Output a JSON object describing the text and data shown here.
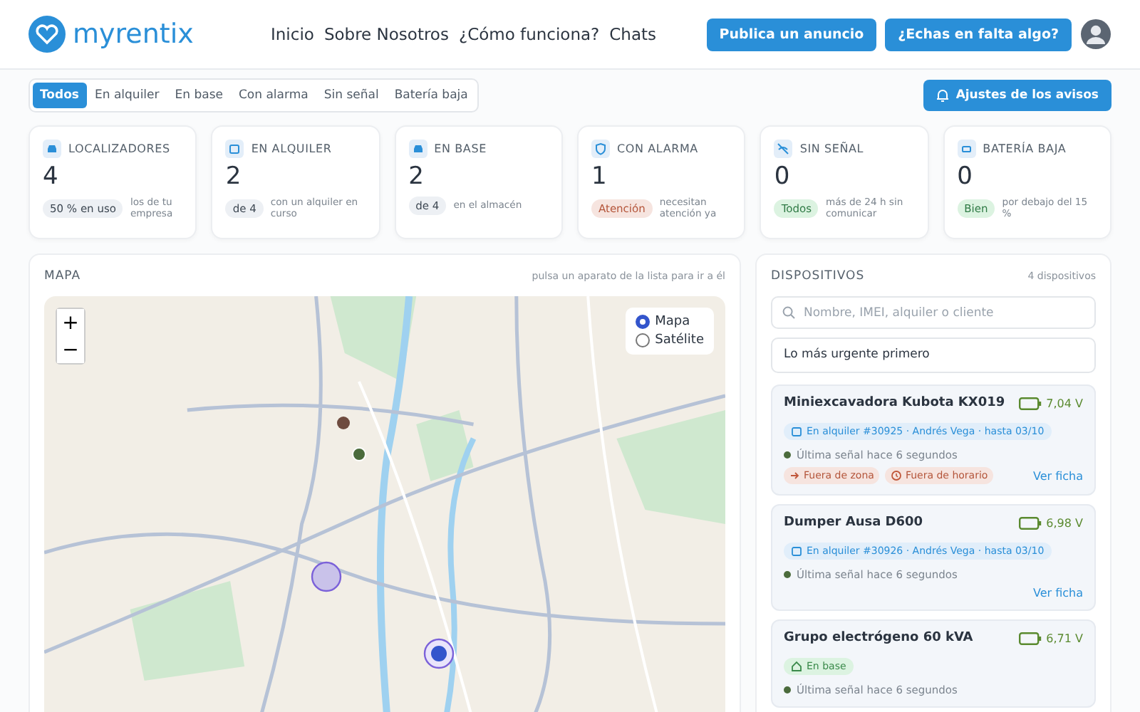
{
  "header": {
    "brand": "myrentix",
    "nav": [
      "Inicio",
      "Sobre Nosotros",
      "¿Cómo funciona?",
      "Chats"
    ],
    "buttons": [
      "Publica un anuncio",
      "¿Echas en falta algo?"
    ]
  },
  "filters": [
    {
      "label": "Todos",
      "selected": true
    },
    {
      "label": "En alquiler",
      "selected": false
    },
    {
      "label": "En base",
      "selected": false
    },
    {
      "label": "Con alarma",
      "selected": false
    },
    {
      "label": "Sin señal",
      "selected": false
    },
    {
      "label": "Batería baja",
      "selected": false
    }
  ],
  "alerts_button": "Ajustes de los avisos",
  "stats": [
    {
      "kind": "trackers",
      "title": "LOCALIZADORES",
      "value": "4",
      "badge": {
        "kind": "neutral",
        "label": "50 % en uso"
      },
      "note": "los de tu empresa"
    },
    {
      "kind": "rental",
      "title": "EN ALQUILER",
      "value": "2",
      "badge": {
        "kind": "neutral",
        "label": "de 4"
      },
      "note": "con un alquiler en curso"
    },
    {
      "kind": "base",
      "title": "EN BASE",
      "value": "2",
      "badge": {
        "kind": "neutral",
        "label": "de 4"
      },
      "note": "en el almacén"
    },
    {
      "kind": "alarm",
      "title": "CON ALARMA",
      "value": "1",
      "badge": {
        "kind": "danger",
        "label": "Atención"
      },
      "note": "necesitan atención ya"
    },
    {
      "kind": "signal",
      "title": "SIN SEÑAL",
      "value": "0",
      "badge": {
        "kind": "success",
        "label": "Todos"
      },
      "note": "más de 24 h sin comunicar"
    },
    {
      "kind": "battery",
      "title": "BATERÍA BAJA",
      "value": "0",
      "badge": {
        "kind": "success",
        "label": "Bien"
      },
      "note": "por debajo del 15 %"
    }
  ],
  "map": {
    "title": "MAPA",
    "hint": "pulsa un aparato de la lista para ir a él",
    "zoom_in": "+",
    "zoom_out": "−",
    "layers": [
      {
        "label": "Mapa",
        "selected": true
      },
      {
        "label": "Satélite",
        "selected": false
      }
    ]
  },
  "devices": {
    "title": "DISPOSITIVOS",
    "count": "4 dispositivos",
    "search": {
      "placeholder": "Nombre, IMEI, alquiler o cliente"
    },
    "sort": "Lo más urgente primero",
    "items": [
      {
        "name": "Miniexcavadora Kubota KX019",
        "voltage": "7,04 V",
        "status": {
          "kind": "rental",
          "label": "En alquiler #30925 · Andrés Vega · hasta 03/10"
        },
        "last_signal": "Última señal hace 6 segundos",
        "alerts": [
          {
            "kind": "zone",
            "label": "Fuera de zona"
          },
          {
            "kind": "schedule",
            "label": "Fuera de horario"
          }
        ],
        "link": "Ver ficha"
      },
      {
        "name": "Dumper Ausa D600",
        "voltage": "6,98 V",
        "status": {
          "kind": "rental",
          "label": "En alquiler #30926 · Andrés Vega · hasta 03/10"
        },
        "last_signal": "Última señal hace 6 segundos",
        "link": "Ver ficha"
      },
      {
        "name": "Grupo electrógeno 60 kVA",
        "voltage": "6,71 V",
        "status": {
          "kind": "base",
          "label": "En base"
        },
        "last_signal": "Última señal hace 6 segundos"
      }
    ]
  }
}
